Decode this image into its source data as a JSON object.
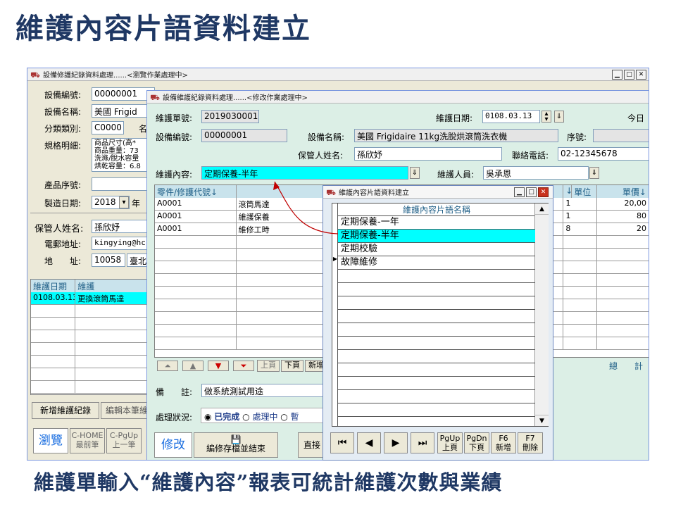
{
  "slide": {
    "title": "維護內容片語資料建立",
    "caption": "維護單輸入“維護內容”報表可統計維護次數與業績"
  },
  "colors": {
    "title": "#1f3864",
    "highlight": "#00ffff",
    "grid_header": "#c9e3ec",
    "annotation_arrow": "#c00000"
  },
  "bg_window": {
    "title": "設備修護紀錄資料處理......<瀏覽作業處理中>",
    "labels": {
      "equip_no": "設備編號:",
      "equip_name": "設備名稱:",
      "category": "分類類別:",
      "spec": "規格明細:",
      "serial": "產品序號:",
      "mfg_date": "製造日期:",
      "keeper": "保管人姓名:",
      "email": "電郵地址:",
      "address": "地　　址:"
    },
    "values": {
      "equip_no": "00000001",
      "equip_name": "美國 Frigid",
      "category": "C0000",
      "category_tail": "名",
      "spec_lines": [
        "商品尺寸(高*",
        "商品重量：73",
        "洗滌/脫水容量",
        "烘乾容量：6.8"
      ],
      "mfg_year": "2018",
      "mfg_year_unit": "年",
      "keeper": "孫欣妤",
      "email": "kingying@hc",
      "zip": "10058",
      "city": "臺北"
    },
    "history": {
      "headers": [
        "維護日期",
        "維護"
      ],
      "rows": [
        [
          "0108.03.13",
          "更換滾筒馬達"
        ]
      ]
    },
    "actions": [
      "新增維護紀錄",
      "編輯本筆維"
    ],
    "mode": "瀏覽",
    "keys": [
      [
        "C-HOME",
        "最前筆"
      ],
      [
        "C-PgUp",
        "上一筆"
      ]
    ]
  },
  "mid_window": {
    "title": "設備維護紀錄資料處理......<修改作業處理中>",
    "labels": {
      "order_no": "維護單號:",
      "order_date": "維護日期:",
      "today": "今日",
      "equip_no": "設備編號:",
      "equip_name": "設備名稱:",
      "seq": "序號:",
      "keeper": "保管人姓名:",
      "phone": "聯絡電話:",
      "content": "維護內容:",
      "staff": "維護人員:",
      "remark": "備　　註:",
      "status": "處理狀況:",
      "total": "總　　計"
    },
    "values": {
      "order_no": "2019030001",
      "order_date": "0108.03.13",
      "equip_no": "00000001",
      "equip_name": "美國 Frigidaire 11kg洗脫烘滾筒洗衣機",
      "keeper": "孫欣妤",
      "phone": "02-12345678",
      "content": "定期保養-半年",
      "staff": "吳承恩",
      "remark": "做系統測試用途"
    },
    "grid": {
      "headers": [
        "零件/修護代號↓",
        "",
        "↓",
        "單位",
        "單價↓"
      ],
      "rows": [
        [
          "A0001",
          "滾筒馬達",
          "1",
          "20,00"
        ],
        [
          "A0001",
          "維護保養",
          "1",
          "80"
        ],
        [
          "A0001",
          "維修工時",
          "8",
          "20"
        ]
      ]
    },
    "nav": [
      "上頁",
      "下頁",
      "新增"
    ],
    "status_options": [
      "已完成",
      "處理中",
      "暫"
    ],
    "mode": "修改",
    "save_button": "編修存檔並結束",
    "direct_button": "直接"
  },
  "front_window": {
    "title": "維護內容片語資料建立",
    "header": "維護內容片語名稱",
    "items": [
      "定期保養-一年",
      "定期保養-半年",
      "定期校驗",
      "故障維修"
    ],
    "selected_index": 1,
    "buttons": [
      [
        "PgUp",
        "上頁"
      ],
      [
        "PgDn",
        "下頁"
      ],
      [
        "F6",
        "新增"
      ],
      [
        "F7",
        "刪除"
      ]
    ]
  }
}
